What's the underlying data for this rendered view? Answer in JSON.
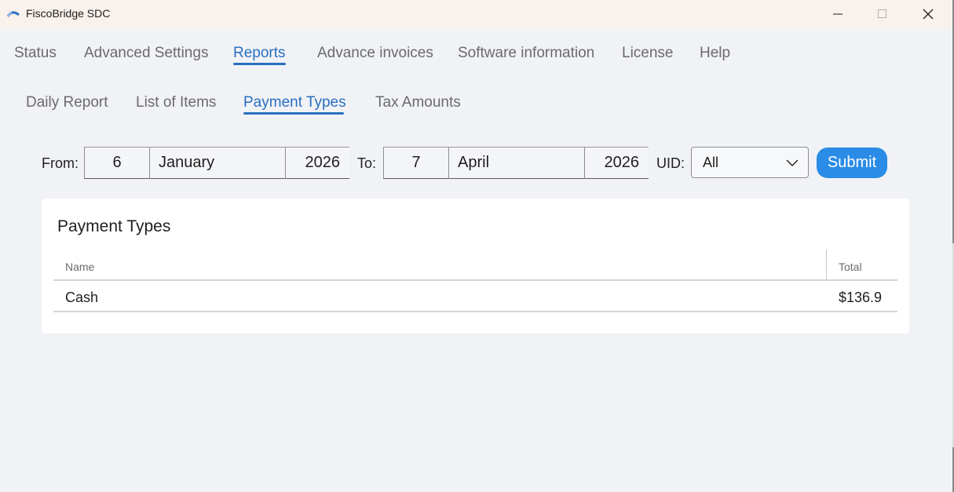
{
  "window": {
    "title": "FiscoBridge SDC"
  },
  "main_tabs": [
    {
      "label": "Status"
    },
    {
      "label": "Advanced Settings"
    },
    {
      "label": "Reports"
    },
    {
      "label": "Advance invoices"
    },
    {
      "label": "Software information"
    },
    {
      "label": "License"
    },
    {
      "label": "Help"
    }
  ],
  "sub_tabs": [
    {
      "label": "Daily Report"
    },
    {
      "label": "List of Items"
    },
    {
      "label": "Payment Types"
    },
    {
      "label": "Tax Amounts"
    }
  ],
  "filter": {
    "from_label": "From:",
    "from_day": "6",
    "from_month": "January",
    "from_year": "2026",
    "to_label": "To:",
    "to_day": "7",
    "to_month": "April",
    "to_year": "2026",
    "uid_label": "UID:",
    "uid_value": "All",
    "submit_label": "Submit"
  },
  "report": {
    "title": "Payment Types",
    "columns": [
      "Name",
      "Total"
    ],
    "rows": [
      {
        "name": "Cash",
        "total": "$136.9"
      }
    ]
  },
  "colors": {
    "accent": "#2a6fc0",
    "submit": "#2a8ce6",
    "titlebar": "#f8f1ec",
    "background": "#f0f2f5"
  }
}
